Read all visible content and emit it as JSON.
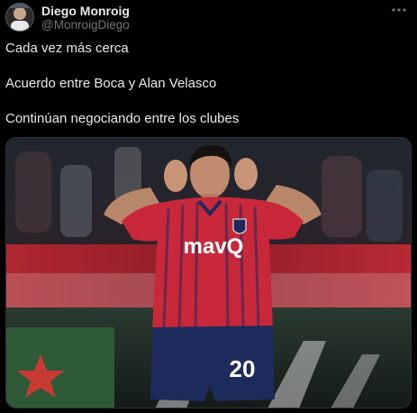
{
  "author": {
    "name": "Diego Monroig",
    "handle": "@MonroigDiego"
  },
  "tweet": {
    "lines": [
      "Cada vez más cerca",
      "Acuerdo entre Boca y Alan Velasco",
      "Continúan negociando entre los clubes"
    ]
  },
  "media": {
    "jersey_sponsor": "mavQ",
    "jersey_number": "20"
  },
  "icons": {
    "more": "more-options-icon"
  },
  "colors": {
    "background": "#000000",
    "text": "#e7e9ea",
    "secondary": "#71767b",
    "jersey_red": "#c8283a",
    "jersey_navy": "#1c2a5c"
  }
}
